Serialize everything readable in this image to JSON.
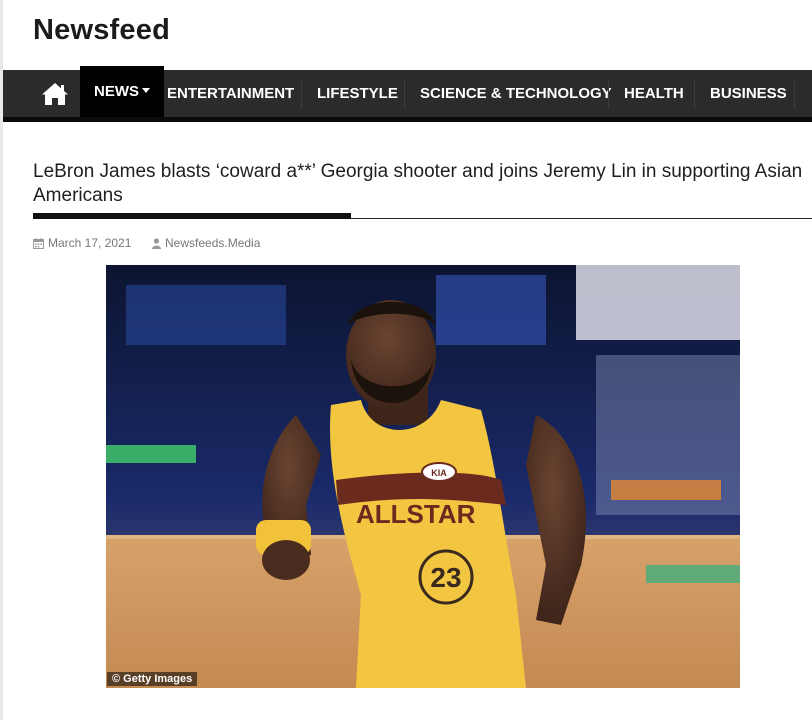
{
  "site": {
    "title": "Newsfeed"
  },
  "nav": {
    "home_icon": "home-icon",
    "items": [
      {
        "label": "NEWS",
        "active": true,
        "has_dropdown": true
      },
      {
        "label": "ENTERTAINMENT"
      },
      {
        "label": "LIFESTYLE"
      },
      {
        "label": "SCIENCE & TECHNOLOGY"
      },
      {
        "label": "HEALTH"
      },
      {
        "label": "BUSINESS"
      }
    ],
    "active_color": "#000000",
    "bar_color": "#2b2b2b"
  },
  "article": {
    "headline": "LeBron James blasts ‘coward a**’ Georgia shooter and joins Jeremy Lin in supporting Asian Americans",
    "date": "March 17, 2021",
    "author": "Newsfeeds.Media",
    "date_icon": "calendar-icon",
    "author_icon": "user-icon",
    "image": {
      "subject": "basketball-player-photo",
      "credit": "© Getty Images",
      "jersey_brand": "KIA",
      "jersey_text": "ALLSTAR",
      "jersey_number": "23"
    }
  }
}
